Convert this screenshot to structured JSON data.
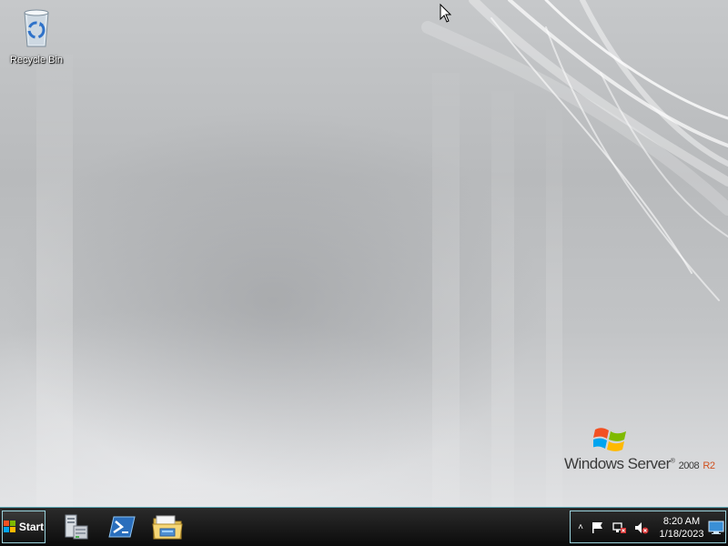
{
  "desktop": {
    "icons": [
      {
        "label": "Recycle Bin",
        "icon": "recycle-bin-icon"
      }
    ],
    "brand": {
      "name": "Windows Server",
      "version": "2008",
      "edition": "R2",
      "logo": "windows-flag-logo"
    }
  },
  "taskbar": {
    "start_label": "Start",
    "pinned": [
      {
        "icon": "server-manager-icon"
      },
      {
        "icon": "powershell-icon"
      },
      {
        "icon": "file-explorer-icon"
      }
    ],
    "tray": {
      "chevron": "˄",
      "icons": [
        "action-center-flag-icon",
        "network-icon",
        "volume-muted-icon"
      ],
      "time": "8:20 AM",
      "date": "1/18/2023"
    }
  },
  "colors": {
    "taskbar_border": "#5aa6b3",
    "edition_accent": "#d0501e"
  }
}
